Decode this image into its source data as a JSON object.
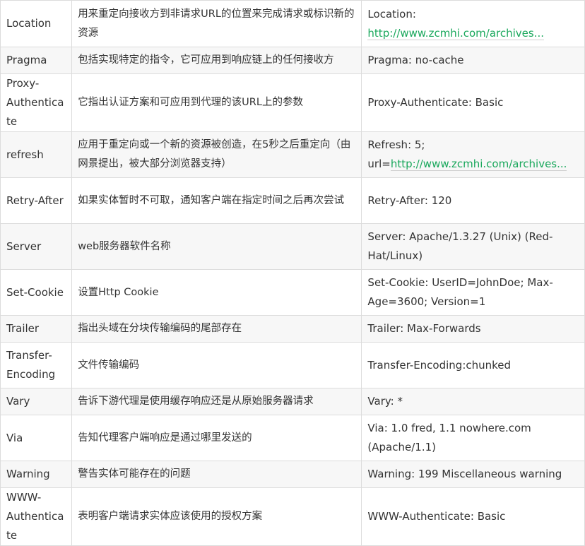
{
  "rows": [
    {
      "header": "Location",
      "description": "用来重定向接收方到非请求URL的位置来完成请求或标识新的资源",
      "example_prefix": "Location:",
      "example_link": "http://www.zcmhi.com/archives..."
    },
    {
      "header": "Pragma",
      "description": "包括实现特定的指令，它可应用到响应链上的任何接收方",
      "example_prefix": "Pragma: no-cache",
      "example_link": ""
    },
    {
      "header": "Proxy-Authenticate",
      "description": "它指出认证方案和可应用到代理的该URL上的参数",
      "example_prefix": "Proxy-Authenticate: Basic",
      "example_link": ""
    },
    {
      "header": "refresh",
      "description": "应用于重定向或一个新的资源被创造，在5秒之后重定向（由网景提出，被大部分浏览器支持）",
      "example_prefix": "Refresh: 5; url=",
      "example_link": "http://www.zcmhi.com/archives..."
    },
    {
      "header": "Retry-After",
      "description": "如果实体暂时不可取，通知客户端在指定时间之后再次尝试",
      "example_prefix": "Retry-After: 120",
      "example_link": ""
    },
    {
      "header": "Server",
      "description": "web服务器软件名称",
      "example_prefix": "Server: Apache/1.3.27 (Unix) (Red-Hat/Linux)",
      "example_link": ""
    },
    {
      "header": "Set-Cookie",
      "description": "设置Http Cookie",
      "example_prefix": "Set-Cookie: UserID=JohnDoe; Max-Age=3600; Version=1",
      "example_link": ""
    },
    {
      "header": "Trailer",
      "description": "指出头域在分块传输编码的尾部存在",
      "example_prefix": "Trailer: Max-Forwards",
      "example_link": ""
    },
    {
      "header": "Transfer-Encoding",
      "description": "文件传输编码",
      "example_prefix": "Transfer-Encoding:chunked",
      "example_link": ""
    },
    {
      "header": "Vary",
      "description": "告诉下游代理是使用缓存响应还是从原始服务器请求",
      "example_prefix": "Vary: *",
      "example_link": ""
    },
    {
      "header": "Via",
      "description": "告知代理客户端响应是通过哪里发送的",
      "example_prefix": "Via: 1.0 fred, 1.1 nowhere.com (Apache/1.1)",
      "example_link": ""
    },
    {
      "header": "Warning",
      "description": "警告实体可能存在的问题",
      "example_prefix": "Warning: 199 Miscellaneous warning",
      "example_link": ""
    },
    {
      "header": "WWW-Authenticate",
      "description": "表明客户端请求实体应该使用的授权方案",
      "example_prefix": "WWW-Authenticate: Basic",
      "example_link": ""
    }
  ],
  "colors": {
    "text": "#333333",
    "link": "#1aa85c",
    "border": "#dcdcdc",
    "row_alt": "#f7f7f7"
  }
}
